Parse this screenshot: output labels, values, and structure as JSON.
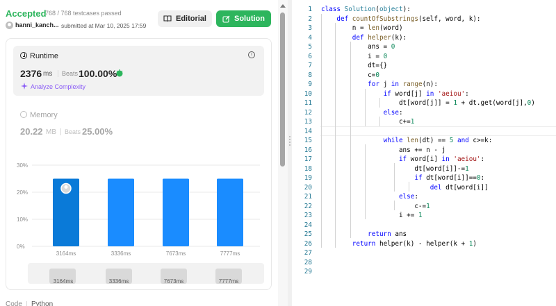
{
  "submission": {
    "status": "Accepted",
    "testcases": "768 / 768 testcases passed",
    "user": "hanni_kanch...",
    "submitted_at": "submitted at Mar 10, 2025 17:59"
  },
  "buttons": {
    "editorial": "Editorial",
    "solution": "Solution"
  },
  "runtime": {
    "label": "Runtime",
    "value": "2376",
    "unit": "ms",
    "beats_label": "Beats",
    "beats_value": "100.00%",
    "analyze": "Analyze Complexity"
  },
  "memory": {
    "label": "Memory",
    "value": "20.22",
    "unit": "MB",
    "beats_label": "Beats",
    "beats_value": "25.00%"
  },
  "chart_data": {
    "type": "bar",
    "categories": [
      "3164ms",
      "3336ms",
      "7673ms",
      "7777ms"
    ],
    "values": [
      25,
      25,
      25,
      25
    ],
    "yticks": [
      "30%",
      "20%",
      "10%",
      "0%"
    ],
    "ylim": [
      0,
      30
    ],
    "highlight_index": 0,
    "colors": {
      "highlight": "#0a7ad8",
      "normal": "#1a8cff"
    }
  },
  "bottom_thumbs": [
    "3164ms",
    "3336ms",
    "7673ms",
    "7777ms"
  ],
  "tabs": {
    "code": "Code",
    "language": "Python"
  },
  "colors": {
    "accepted": "#2db55d",
    "beats_runtime": "#262626",
    "analyze": "#8a5cf6"
  },
  "editor": {
    "line_numbers": [
      "1",
      "2",
      "3",
      "4",
      "5",
      "6",
      "7",
      "8",
      "9",
      "10",
      "11",
      "12",
      "13",
      "14",
      "15",
      "16",
      "17",
      "18",
      "19",
      "20",
      "21",
      "22",
      "23",
      "24",
      "25",
      "26",
      "27",
      "28",
      "29"
    ]
  }
}
